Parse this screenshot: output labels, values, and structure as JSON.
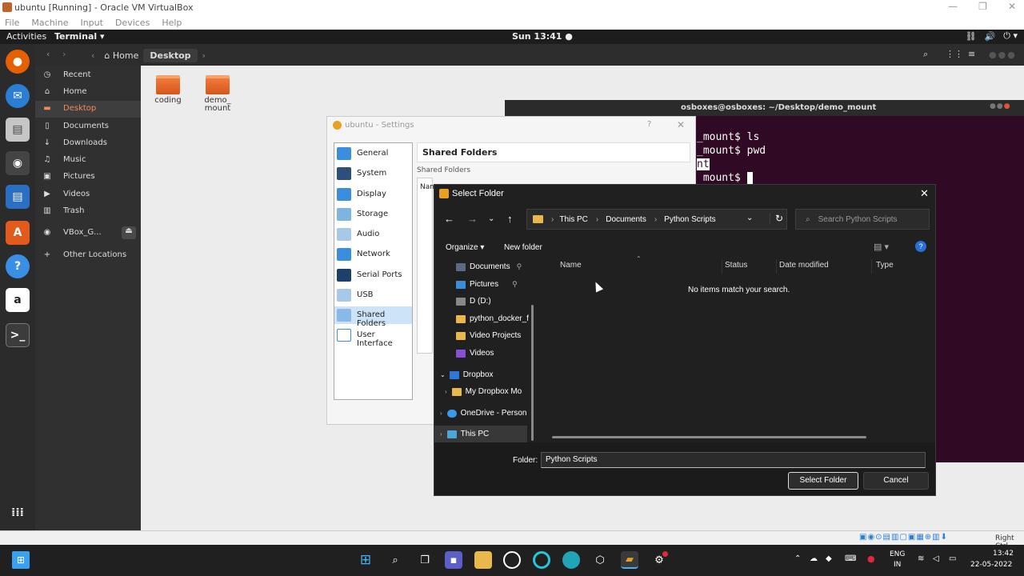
{
  "host": {
    "window_title": "ubuntu [Running] - Oracle VM VirtualBox",
    "menu": [
      "File",
      "Machine",
      "Input",
      "Devices",
      "Help"
    ],
    "host_key": "Right Ctrl"
  },
  "ubuntu_topbar": {
    "activities": "Activities",
    "app_menu": "Terminal ▾",
    "clock": "Sun 13:41 ●"
  },
  "nautilus": {
    "path": [
      "Home",
      "Desktop"
    ],
    "sidebar": [
      {
        "label": "Recent",
        "icon": "clock-icon"
      },
      {
        "label": "Home",
        "icon": "home-icon"
      },
      {
        "label": "Desktop",
        "icon": "desktop-icon",
        "active": true
      },
      {
        "label": "Documents",
        "icon": "document-icon"
      },
      {
        "label": "Downloads",
        "icon": "download-icon"
      },
      {
        "label": "Music",
        "icon": "music-icon"
      },
      {
        "label": "Pictures",
        "icon": "picture-icon"
      },
      {
        "label": "Videos",
        "icon": "video-icon"
      },
      {
        "label": "Trash",
        "icon": "trash-icon"
      },
      {
        "label": "VBox_G...",
        "icon": "disc-icon"
      },
      {
        "label": "Other Locations",
        "icon": "plus-icon"
      }
    ],
    "folders": [
      "coding",
      "demo_\nmount"
    ]
  },
  "terminal": {
    "title": "osboxes@osboxes: ~/Desktop/demo_mount",
    "lines": [
      "_mount$ ls",
      "_mount$ pwd",
      "nt",
      " mount$ "
    ]
  },
  "settings": {
    "title": "ubuntu - Settings",
    "help": "?",
    "items": [
      "General",
      "System",
      "Display",
      "Storage",
      "Audio",
      "Network",
      "Serial Ports",
      "USB",
      "Shared Folders",
      "User Interface"
    ],
    "selected": "Shared Folders",
    "panel_title": "Shared Folders",
    "group_label": "Shared Folders",
    "col_name": "Nam"
  },
  "dialog": {
    "title": "Select Folder",
    "breadcrumb": [
      "This PC",
      "Documents",
      "Python Scripts"
    ],
    "search_placeholder": "Search Python Scripts",
    "organize": "Organize ▾",
    "new_folder": "New folder",
    "nav": [
      {
        "label": "Documents",
        "pin": true,
        "color": "#5a6a80"
      },
      {
        "label": "Pictures",
        "pin": true,
        "color": "#3a8fd8"
      },
      {
        "label": "D (D:)",
        "pin": false,
        "color": "#888888"
      },
      {
        "label": "python_docker_f",
        "pin": false,
        "color": "#e8b94a"
      },
      {
        "label": "Video Projects",
        "pin": false,
        "color": "#e8b94a"
      },
      {
        "label": "Videos",
        "pin": false,
        "color": "#8a4fd8"
      },
      {
        "label": "Dropbox",
        "pin": false,
        "color": "#2f76d8"
      },
      {
        "label": "My Dropbox Mo",
        "pin": false,
        "color": "#e8b94a"
      },
      {
        "label": "OneDrive - Person",
        "pin": false,
        "color": "#3a9ae8"
      },
      {
        "label": "This PC",
        "pin": false,
        "color": "#4aa8d8"
      }
    ],
    "columns": [
      "Name",
      "Status",
      "Date modified",
      "Type"
    ],
    "empty_message": "No items match your search.",
    "folder_label": "Folder:",
    "folder_value": "Python Scripts",
    "select_button": "Select Folder",
    "cancel_button": "Cancel"
  },
  "taskbar": {
    "lang": "ENG",
    "region": "IN",
    "time": "13:42",
    "date": "22-05-2022"
  }
}
